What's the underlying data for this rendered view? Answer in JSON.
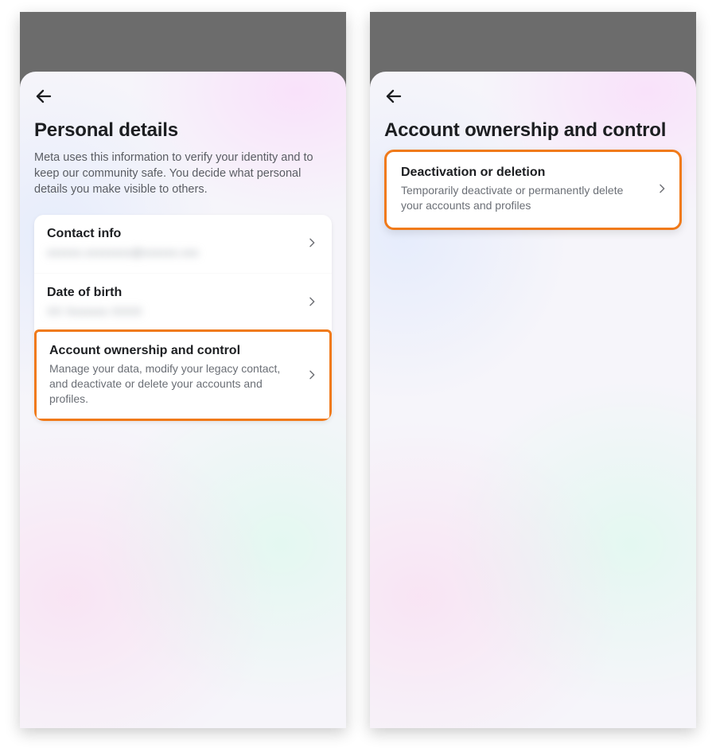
{
  "left": {
    "title": "Personal details",
    "description": "Meta uses this information to verify your identity and to keep our community safe. You decide what personal details you make visible to others.",
    "rows": {
      "contact": {
        "title": "Contact info",
        "sub_redacted": "xxxxxx.xxxxxxxx@xxxxxx.xxx"
      },
      "dob": {
        "title": "Date of birth",
        "sub_redacted": "XX Xxxxxxx XXXX"
      },
      "ownership": {
        "title": "Account ownership and control",
        "sub": "Manage your data, modify your legacy contact, and deactivate or delete your accounts and profiles."
      }
    }
  },
  "right": {
    "title": "Account ownership and control",
    "rows": {
      "deactivate": {
        "title": "Deactivation or deletion",
        "sub": "Temporarily deactivate or permanently delete your accounts and profiles"
      }
    }
  },
  "colors": {
    "highlight": "#f07a1a"
  }
}
